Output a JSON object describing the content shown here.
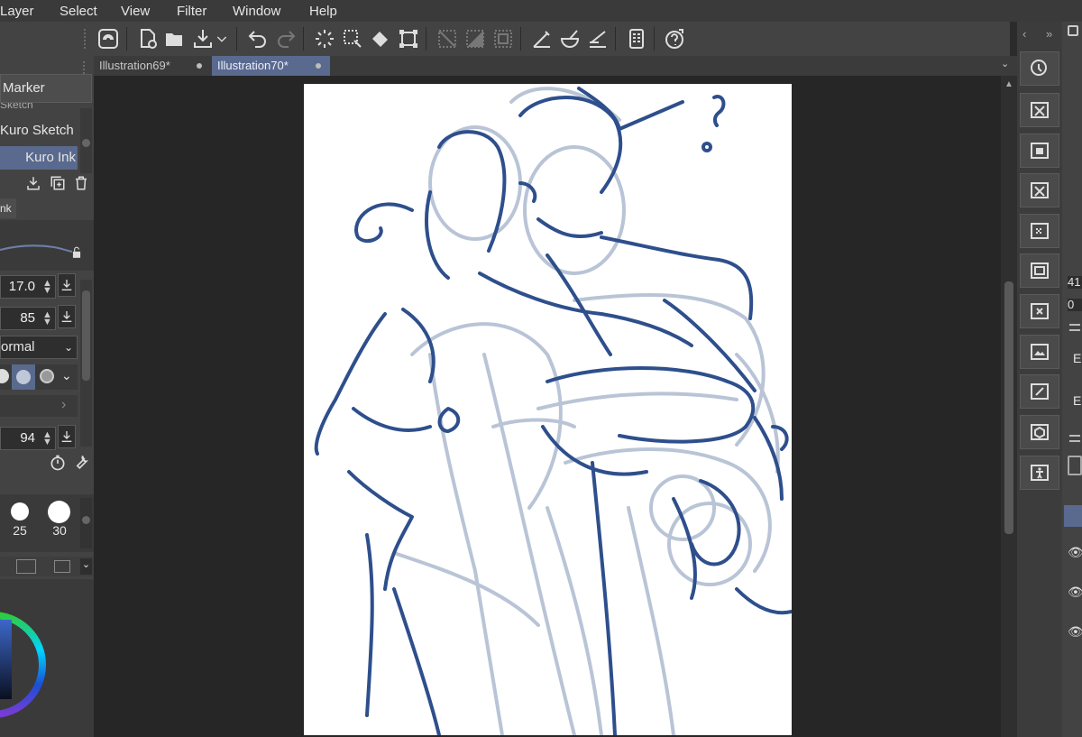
{
  "menu": [
    "Layer",
    "Select",
    "View",
    "Filter",
    "Window",
    "Help"
  ],
  "tabs": [
    {
      "label": "Illustration69*",
      "active": false
    },
    {
      "label": "Illustration70*",
      "active": true
    }
  ],
  "left_panel": {
    "title": "Marker",
    "brushes": [
      "Kuro Sketch",
      "Kuro Ink"
    ],
    "partial_brush": "Sketch",
    "subtab_fragment": "nk",
    "brush_size": "17.0",
    "opacity": "85",
    "blend_mode": "ormal",
    "stabilization": "94",
    "size_presets": [
      "25",
      "30"
    ]
  },
  "right_edge": {
    "values": [
      "41",
      "0"
    ],
    "labels": [
      "E",
      "E"
    ]
  },
  "colors": {
    "accent": "#596a8e",
    "sketch_light": "#b9c4d6",
    "sketch_dark": "#2e4f8c"
  }
}
